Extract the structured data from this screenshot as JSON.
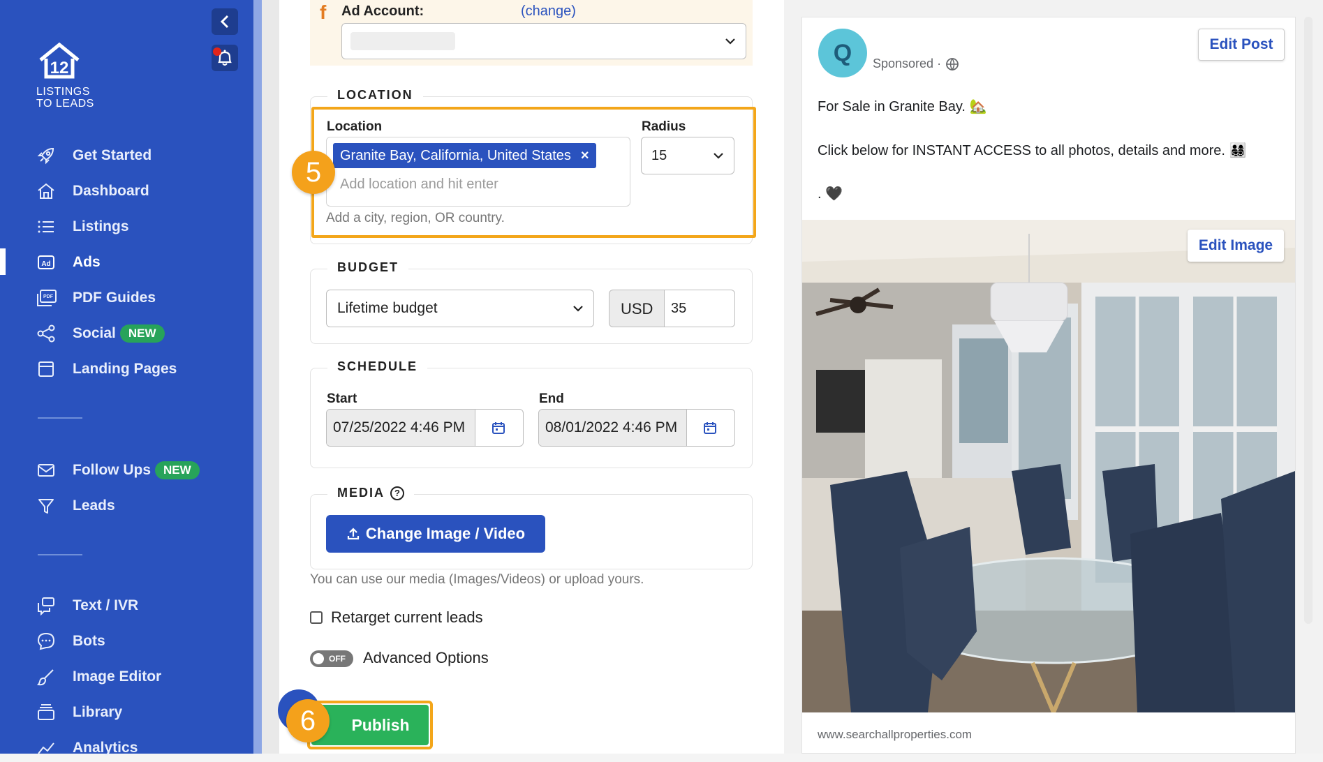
{
  "sidebar": {
    "logo_mark": "12",
    "logo_line1": "LISTINGS",
    "logo_line2": "TO LEADS",
    "items": [
      {
        "label": "Get Started"
      },
      {
        "label": "Dashboard"
      },
      {
        "label": "Listings"
      },
      {
        "label": "Ads"
      },
      {
        "label": "PDF Guides"
      },
      {
        "label": "Social",
        "badge": "NEW"
      },
      {
        "label": "Landing Pages"
      },
      {
        "label": "Follow Ups",
        "badge": "NEW"
      },
      {
        "label": "Leads"
      },
      {
        "label": "Text / IVR"
      },
      {
        "label": "Bots"
      },
      {
        "label": "Image Editor"
      },
      {
        "label": "Library"
      },
      {
        "label": "Analytics"
      }
    ],
    "active": "Ads",
    "icons": [
      "rocket-icon",
      "home-icon",
      "list-icon",
      "ad-icon",
      "pdf-icon",
      "share-icon",
      "layout-icon",
      "mail-icon",
      "filter-icon",
      "chat-icon",
      "bot-icon",
      "brush-icon",
      "library-icon",
      "analytics-icon"
    ]
  },
  "ad_account": {
    "label": "Ad Account:",
    "change": "(change)",
    "value": ""
  },
  "location": {
    "legend": "LOCATION",
    "label": "Location",
    "tag": "Granite Bay, California, United States",
    "tag_remove": "×",
    "placeholder": "Add location and hit enter",
    "hint": "Add a city, region, OR country.",
    "radius_label": "Radius",
    "radius_value": "15",
    "step": "5"
  },
  "budget": {
    "legend": "BUDGET",
    "type": "Lifetime budget",
    "currency": "USD",
    "amount": "35"
  },
  "schedule": {
    "legend": "SCHEDULE",
    "start_label": "Start",
    "start_value": "07/25/2022 4:46 PM",
    "end_label": "End",
    "end_value": "08/01/2022 4:46 PM"
  },
  "media": {
    "legend": "MEDIA",
    "help": "?",
    "button": "Change Image / Video",
    "hint": "You can use our media (Images/Videos) or upload yours."
  },
  "retarget_label": "Retarget current leads",
  "advanced": {
    "toggle": "OFF",
    "label": "Advanced Options"
  },
  "publish": {
    "label": "Publish",
    "step": "6"
  },
  "preview": {
    "avatar": "Q",
    "sponsored": "Sponsored ·",
    "edit_post": "Edit Post",
    "line1": "For Sale in Granite Bay. 🏡",
    "line2": "Click below for INSTANT ACCESS to all photos, details and more. 👨‍👩‍👧‍👦",
    "line3": ". 🖤",
    "edit_image": "Edit Image",
    "url": "www.searchallproperties.com"
  },
  "colors": {
    "brand": "#2a52be",
    "highlight": "#f3a61a",
    "publish": "#2ab25a",
    "new_badge": "#27a35a"
  }
}
